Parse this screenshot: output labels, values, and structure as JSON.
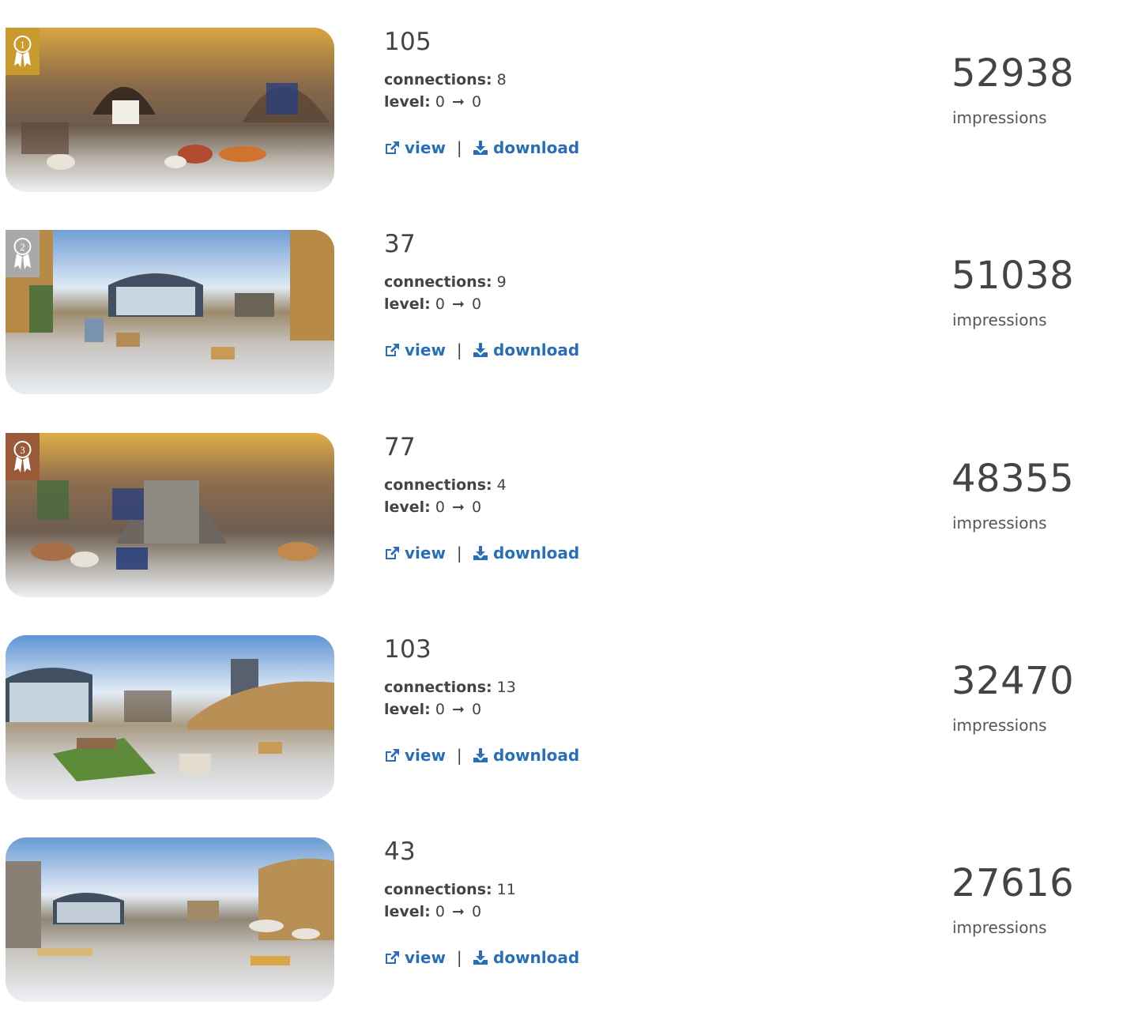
{
  "labels": {
    "connections": "connections:",
    "level": "level:",
    "level_arrow": "➞",
    "view": "view",
    "download": "download",
    "separator": "|",
    "impressions": "impressions"
  },
  "colors": {
    "link": "#2a6fb4",
    "text": "#444444",
    "gold": "#c99a2e",
    "silver": "#a9a9a9",
    "bronze": "#9a5a3a"
  },
  "items": [
    {
      "id": "105",
      "connections": "8",
      "level_from": "0",
      "level_to": "0",
      "impressions": "52938",
      "award": "gold",
      "award_rank": "1",
      "scene": "indoor-warm",
      "icons": [
        "external-link-icon",
        "download-icon"
      ]
    },
    {
      "id": "37",
      "connections": "9",
      "level_from": "0",
      "level_to": "0",
      "impressions": "51038",
      "award": "silver",
      "award_rank": "2",
      "scene": "outdoor-sky"
    },
    {
      "id": "77",
      "connections": "4",
      "level_from": "0",
      "level_to": "0",
      "impressions": "48355",
      "award": "bronze",
      "award_rank": "3",
      "scene": "indoor-warm"
    },
    {
      "id": "103",
      "connections": "13",
      "level_from": "0",
      "level_to": "0",
      "impressions": "32470",
      "award": "",
      "award_rank": "",
      "scene": "outdoor-sky"
    },
    {
      "id": "43",
      "connections": "11",
      "level_from": "0",
      "level_to": "0",
      "impressions": "27616",
      "award": "",
      "award_rank": "",
      "scene": "outdoor-sky"
    }
  ]
}
